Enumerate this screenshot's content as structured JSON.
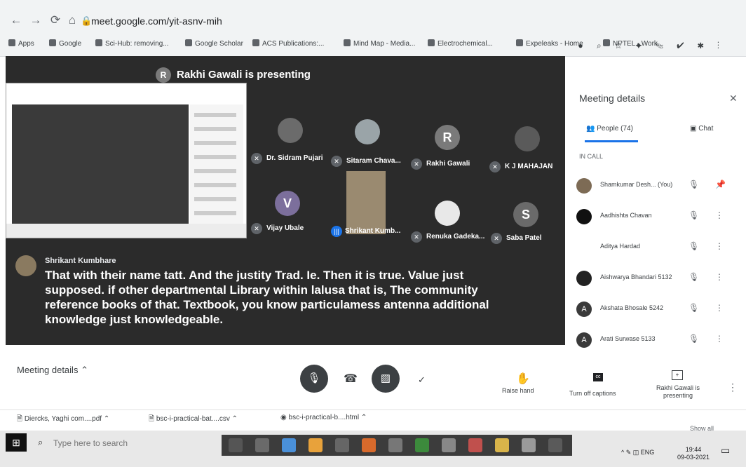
{
  "browser": {
    "url": "meet.google.com/yit-asnv-mih",
    "bookmarks": [
      "Apps",
      "Google",
      "Sci-Hub: removing...",
      "Google Scholar",
      "ACS Publications:...",
      "Mind Map - Media...",
      "Electrochemical...",
      "Expeleaks - Home",
      "NPTEL - Work..."
    ]
  },
  "stage": {
    "presenter_initial": "R",
    "presenting_text": "Rakhi Gawali is presenting",
    "participants": [
      {
        "name": "Dr. Sidram Pujari",
        "initial": ""
      },
      {
        "name": "Sitaram Chava...",
        "initial": ""
      },
      {
        "name": "Rakhi Gawali",
        "initial": "R"
      },
      {
        "name": "K J MAHAJAN",
        "initial": ""
      },
      {
        "name": "Vijay Ubale",
        "initial": "V"
      },
      {
        "name": "Shrikant Kumb...",
        "initial": ""
      },
      {
        "name": "Renuka Gadeka...",
        "initial": ""
      },
      {
        "name": "Saba Patel",
        "initial": "S"
      }
    ]
  },
  "caption": {
    "speaker": "Shrikant Kumbhare",
    "text": "That with their name tatt. And the justity Trad. Ie. Then it is true. Value just supposed. if other departmental Library within lalusa that is, The community reference books of that. Textbook, you know particulamess antenna additional knowledge just knowledgeable."
  },
  "panel": {
    "title": "Meeting details",
    "people_tab": "People (74)",
    "chat_tab": "Chat",
    "section": "IN CALL",
    "people": [
      {
        "name": "Shamkumar Desh... (You)",
        "initial": ""
      },
      {
        "name": "Aadhishta Chavan",
        "initial": ""
      },
      {
        "name": "Aditya Hardad",
        "initial": ""
      },
      {
        "name": "Aishwarya Bhandari 5132",
        "initial": ""
      },
      {
        "name": "Akshata Bhosale 5242",
        "initial": "A"
      },
      {
        "name": "Arati Surwase 5133",
        "initial": "A"
      }
    ]
  },
  "bottom": {
    "meeting_details": "Meeting details",
    "raise_hand": "Raise hand",
    "captions": "Turn off captions",
    "presenting": "Rakhi Gawali is presenting"
  },
  "downloads": [
    {
      "name": "Diercks, Yaghi com....pdf"
    },
    {
      "name": "bsc-i-practical-bat....csv"
    },
    {
      "name": "bsc-i-practical-b....html"
    }
  ],
  "downloads_show_all": "Show all",
  "taskbar": {
    "search_placeholder": "Type here to search",
    "lang": "ENG",
    "time": "19:44",
    "date": "09-03-2021"
  }
}
